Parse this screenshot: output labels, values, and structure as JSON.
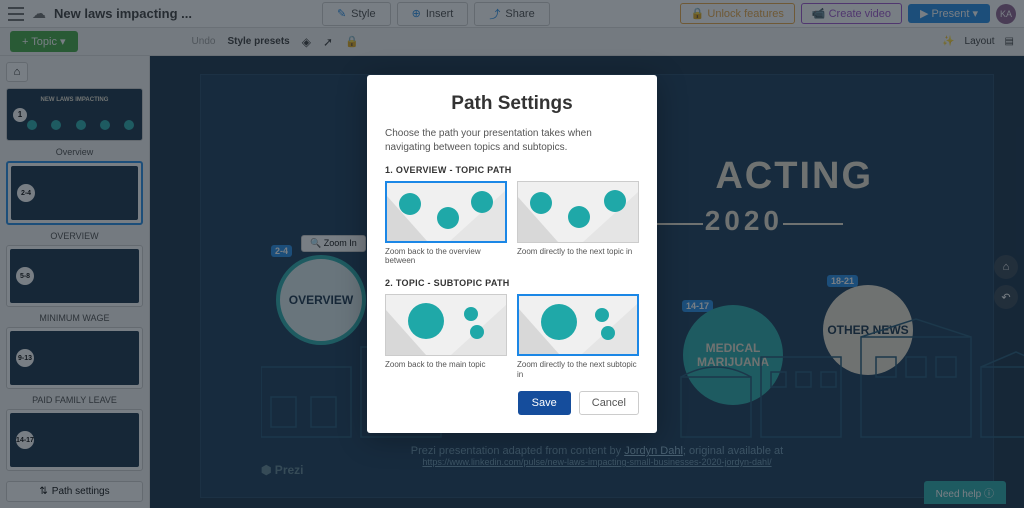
{
  "header": {
    "title": "New laws impacting ...",
    "style": "Style",
    "insert": "Insert",
    "share": "Share",
    "unlock": "🔒 Unlock features",
    "create_video": "📹 Create video",
    "present": "▶ Present ▾",
    "avatar": "KA"
  },
  "toolbar": {
    "topic": "+ Topic ▾",
    "undo": "Undo",
    "style_presets": "Style presets",
    "layout": "Layout"
  },
  "sidebar": {
    "overview_label": "Overview",
    "overview_thumb_title": "NEW LAWS IMPACTING",
    "overview_badge": "1",
    "items": [
      {
        "badge": "2-4",
        "label": "OVERVIEW"
      },
      {
        "badge": "5-8",
        "label": "MINIMUM WAGE"
      },
      {
        "badge": "9-13",
        "label": "PAID FAMILY LEAVE"
      },
      {
        "badge": "14-17",
        "label": ""
      }
    ],
    "path_settings": "Path settings"
  },
  "canvas": {
    "title": "ACTING",
    "year": "2020",
    "overview_label": "OVERVIEW",
    "overview_badge": "2-4",
    "zoom_in": "🔍 Zoom In",
    "medical": "MEDICAL MARIJUANA",
    "medical_badge": "14-17",
    "other": "OTHER NEWS",
    "other_badge": "18-21",
    "credit1_a": "Prezi presentation adapted from content by ",
    "credit1_b": "Jordyn Dahl",
    "credit1_c": "; original available at",
    "credit2": "https://www.linkedin.com/pulse/new-laws-impacting-small-businesses-2020-jordyn-dahl/",
    "prezi": "⬢ Prezi",
    "need_help": "Need help   ⓘ"
  },
  "modal": {
    "title": "Path Settings",
    "description": "Choose the path your presentation takes when navigating between topics and subtopics.",
    "section1": "1. OVERVIEW - TOPIC PATH",
    "opt1a": "Zoom back to the overview between",
    "opt1b": "Zoom directly to the next topic in",
    "section2": "2. TOPIC - SUBTOPIC PATH",
    "opt2a": "Zoom back to the main topic",
    "opt2b": "Zoom directly to the next subtopic in",
    "save": "Save",
    "cancel": "Cancel"
  }
}
